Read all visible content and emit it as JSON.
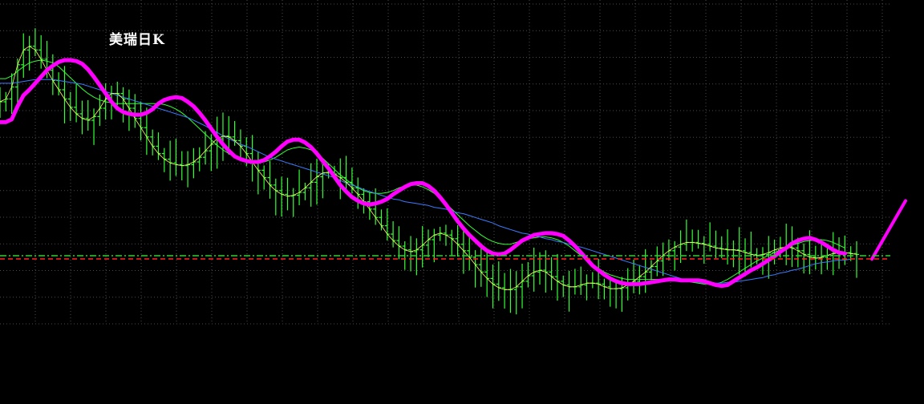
{
  "chart_data": {
    "type": "line",
    "title": "美瑞日K",
    "background_color": "#000000",
    "grid": true,
    "grid_color": "#4a4a4a",
    "price_bar_color": "#33ff33",
    "series": [
      {
        "color": "#ff00ff",
        "values": [
          59.8,
          59.8,
          60.1,
          61.5,
          62.7,
          63.3,
          64.0,
          64.7,
          65.4,
          65.9,
          66.3,
          66.5,
          66.5,
          66.4,
          66.1,
          65.5,
          64.7,
          63.8,
          62.9,
          62.0,
          61.3,
          60.9,
          60.7,
          60.6,
          60.6,
          60.8,
          61.2,
          61.8,
          62.2,
          62.4,
          62.5,
          62.4,
          62.0,
          61.5,
          60.8,
          60.0,
          59.1,
          58.2,
          57.4,
          56.7,
          56.1,
          55.8,
          55.6,
          55.5,
          55.5,
          55.7,
          56.1,
          56.6,
          57.2,
          57.7,
          57.9,
          57.9,
          57.6,
          57.1,
          56.4,
          55.6,
          54.8,
          53.9,
          53.0,
          52.3,
          51.7,
          51.3,
          51.0,
          50.9,
          51.0,
          51.2,
          51.5,
          52.0,
          52.4,
          52.8,
          53.1,
          53.2,
          53.2,
          52.9,
          52.4,
          51.7,
          50.9,
          50.0,
          49.1,
          48.3,
          47.6,
          47.0,
          46.4,
          45.9,
          45.6,
          45.5,
          45.6,
          46.0,
          46.5,
          47.0,
          47.3,
          47.6,
          47.7,
          47.8,
          47.8,
          47.7,
          47.5,
          47.0,
          46.4,
          45.7,
          45.0,
          44.3,
          43.8,
          43.3,
          42.9,
          42.6,
          42.4,
          42.3,
          42.3,
          42.3,
          42.4,
          42.5,
          42.6,
          42.7,
          42.8,
          42.8,
          42.7,
          42.7,
          42.7,
          42.7,
          42.6,
          42.4,
          42.2,
          42.1,
          42.2,
          42.6,
          43.0,
          43.4,
          43.8,
          44.1,
          44.5,
          44.9,
          45.3,
          45.8,
          46.2,
          46.7,
          47.0,
          47.2,
          47.3,
          47.1,
          46.8,
          46.4,
          46.0,
          45.7,
          45.6
        ]
      },
      {
        "color": "#3b7bff",
        "values": [
          64.0,
          64.0,
          64.0,
          64.1,
          64.2,
          64.3,
          64.4,
          64.4,
          64.4,
          64.4,
          64.3,
          64.2,
          64.1,
          64.0,
          63.9,
          63.7,
          63.5,
          63.3,
          63.1,
          62.9,
          62.7,
          62.5,
          62.3,
          62.1,
          61.9,
          61.7,
          61.5,
          61.3,
          61.1,
          60.9,
          60.7,
          60.5,
          60.3,
          60.0,
          59.7,
          59.4,
          59.0,
          58.7,
          58.3,
          58.0,
          57.7,
          57.4,
          57.2,
          56.9,
          56.6,
          56.3,
          56.0,
          55.8,
          55.6,
          55.4,
          55.2,
          55.0,
          54.8,
          54.6,
          54.4,
          54.2,
          54.0,
          53.8,
          53.5,
          53.2,
          53.0,
          52.8,
          52.5,
          52.3,
          52.1,
          51.9,
          51.7,
          51.5,
          51.4,
          51.2,
          51.1,
          51.0,
          50.9,
          50.8,
          50.6,
          50.5,
          50.4,
          50.2,
          50.0,
          49.9,
          49.7,
          49.5,
          49.3,
          49.1,
          48.9,
          48.6,
          48.4,
          48.2,
          48.0,
          47.8,
          47.7,
          47.5,
          47.4,
          47.2,
          47.1,
          46.9,
          46.8,
          46.6,
          46.4,
          46.3,
          46.1,
          45.9,
          45.7,
          45.5,
          45.3,
          45.1,
          44.9,
          44.7,
          44.5,
          44.3,
          44.1,
          43.9,
          43.7,
          43.5,
          43.3,
          43.1,
          42.9,
          42.7,
          42.6,
          42.5,
          42.4,
          42.4,
          42.4,
          42.4,
          42.5,
          42.5,
          42.6,
          42.7,
          42.8,
          42.9,
          43.0,
          43.2,
          43.3,
          43.5,
          43.6,
          43.8,
          43.9,
          44.1,
          44.3,
          44.5,
          44.6,
          44.7,
          44.8,
          44.9,
          44.9,
          45.0
        ]
      },
      {
        "color": "#33ff33",
        "values": [
          64.5,
          64.5,
          64.8,
          65.3,
          65.8,
          66.2,
          66.4,
          66.5,
          66.4,
          66.2,
          65.8,
          65.2,
          64.6,
          64.0,
          63.4,
          62.9,
          62.5,
          62.2,
          62.0,
          61.9,
          61.8,
          61.8,
          61.8,
          61.8,
          61.8,
          61.8,
          61.8,
          61.8,
          61.7,
          61.5,
          61.2,
          60.8,
          60.3,
          59.7,
          59.1,
          58.5,
          57.9,
          57.3,
          56.8,
          56.4,
          56.0,
          55.7,
          55.5,
          55.4,
          55.4,
          55.5,
          55.7,
          56.0,
          56.4,
          56.8,
          57.0,
          57.1,
          57.0,
          56.8,
          56.4,
          55.9,
          55.3,
          54.7,
          54.1,
          53.6,
          53.1,
          52.7,
          52.4,
          52.2,
          52.1,
          52.1,
          52.2,
          52.4,
          52.7,
          52.9,
          53.0,
          53.0,
          52.8,
          52.5,
          52.1,
          51.6,
          51.0,
          50.4,
          49.8,
          49.2,
          48.6,
          48.1,
          47.6,
          47.2,
          46.9,
          46.7,
          46.6,
          46.6,
          46.8,
          47.0,
          47.2,
          47.3,
          47.4,
          47.4,
          47.3,
          47.1,
          46.8,
          46.4,
          45.9,
          45.4,
          44.9,
          44.4,
          44.0,
          43.6,
          43.3,
          43.1,
          42.9,
          42.8,
          42.8,
          42.8,
          42.8,
          42.8,
          42.8,
          42.8,
          42.8,
          42.8,
          42.7,
          42.6,
          42.5,
          42.4,
          42.3,
          42.3,
          42.3,
          42.5,
          42.8,
          43.2,
          43.6,
          44.0,
          44.4,
          44.8,
          45.1,
          45.4,
          45.7,
          46.0,
          46.3,
          46.5,
          46.7,
          46.9,
          47.0,
          47.1,
          47.1,
          47.0,
          46.8,
          46.5,
          46.2
        ]
      },
      {
        "color": "#ffff66",
        "values": [
          62.0,
          62.3,
          63.6,
          66.0,
          67.6,
          68.0,
          67.6,
          66.6,
          65.4,
          64.3,
          63.3,
          62.3,
          61.4,
          60.7,
          60.2,
          60.0,
          60.4,
          61.3,
          62.3,
          62.9,
          62.9,
          62.3,
          61.3,
          60.2,
          59.2,
          58.2,
          57.2,
          56.4,
          55.8,
          55.4,
          55.2,
          55.1,
          55.2,
          55.5,
          56.0,
          56.7,
          57.4,
          58.0,
          58.3,
          58.2,
          57.8,
          57.2,
          56.4,
          55.5,
          54.6,
          53.8,
          53.0,
          52.4,
          52.0,
          51.8,
          51.9,
          52.2,
          52.7,
          53.3,
          53.9,
          54.3,
          54.4,
          54.2,
          53.8,
          53.3,
          52.7,
          52.0,
          51.2,
          50.4,
          49.5,
          48.6,
          47.7,
          47.0,
          46.4,
          46.0,
          45.8,
          46.0,
          46.5,
          47.1,
          47.6,
          47.8,
          47.6,
          47.2,
          46.6,
          45.9,
          45.2,
          44.4,
          43.6,
          42.9,
          42.3,
          41.9,
          41.7,
          41.7,
          42.0,
          42.6,
          43.2,
          43.6,
          43.8,
          43.6,
          43.1,
          42.6,
          42.2,
          42.0,
          42.0,
          42.2,
          42.4,
          42.4,
          42.3,
          42.0,
          41.8,
          41.8,
          41.9,
          42.2,
          42.6,
          43.1,
          43.6,
          44.2,
          44.8,
          45.4,
          45.9,
          46.3,
          46.6,
          46.8,
          46.8,
          46.7,
          46.6,
          46.4,
          46.2,
          46.1,
          46.0,
          46.0,
          45.9,
          45.7,
          45.5,
          45.4,
          45.5,
          45.7,
          46.0,
          46.2,
          46.3,
          46.2,
          45.9,
          45.5,
          45.2,
          45.1,
          45.2,
          45.4,
          45.6,
          45.7,
          45.7,
          45.6,
          45.5
        ]
      }
    ],
    "projection": {
      "color": "#ff00ff",
      "values": [
        45.0,
        51.3
      ]
    }
  }
}
